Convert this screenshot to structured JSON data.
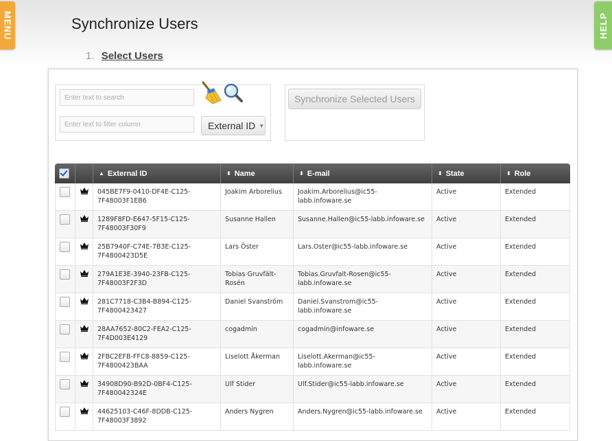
{
  "sidebar": {
    "menu_label": "MENU",
    "help_label": "HELP"
  },
  "header": {
    "title": "Synchronize Users",
    "step_number": "1.",
    "step_label": "Select Users"
  },
  "search": {
    "search_placeholder": "Enter text to search",
    "filter_placeholder": "Enter text to filter column",
    "column_selected": "External ID",
    "clear_icon": "broom-icon",
    "search_icon": "magnifier-icon"
  },
  "actions": {
    "sync_button_label": "Synchronize Selected Users"
  },
  "grid": {
    "columns": [
      {
        "label": "External ID",
        "sort": "▲"
      },
      {
        "label": "Name",
        "sort": "⬍"
      },
      {
        "label": "E-mail",
        "sort": "⬍"
      },
      {
        "label": "State",
        "sort": "⬍"
      },
      {
        "label": "Role",
        "sort": "⬍"
      }
    ],
    "row_icon": "crown-icon",
    "rows": [
      {
        "external_id": "045BE7F9-0410-DF4E-C125-7F48003F1EB6",
        "name": "Joakim Arborelius",
        "email": "Joakim.Arborelius@ic55-labb.infoware.se",
        "state": "Active",
        "role": "Extended"
      },
      {
        "external_id": "1289F8FD-E647-5F15-C125-7F48003F30F9",
        "name": "Susanne Hallen",
        "email": "Susanne.Hallen@ic55-labb.infoware.se",
        "state": "Active",
        "role": "Extended"
      },
      {
        "external_id": "25B7940F-C74E-7B3E-C125-7F4800423D5E",
        "name": "Lars Öster",
        "email": "Lars.Oster@ic55-labb.infoware.se",
        "state": "Active",
        "role": "Extended"
      },
      {
        "external_id": "279A1E3E-3940-23FB-C125-7F48003F2F3D",
        "name": "Tobias Gruvfält-Rosén",
        "email": "Tobias.Gruvfalt-Rosen@ic55-labb.infoware.se",
        "state": "Active",
        "role": "Extended"
      },
      {
        "external_id": "281C7718-C3B4-B894-C125-7F4800423427",
        "name": "Daniel Svanström",
        "email": "Daniel.Svanstrom@ic55-labb.infoware.se",
        "state": "Active",
        "role": "Extended"
      },
      {
        "external_id": "28AA7652-80C2-FEA2-C125-7F4D003E4129",
        "name": "cogadmin",
        "email": "cogadmin@infoware.se",
        "state": "Active",
        "role": "Extended"
      },
      {
        "external_id": "2FBC2EFB-FFC8-8859-C125-7F4800423BAA",
        "name": "Liselott Åkerman",
        "email": "Liselott.Akerman@ic55-labb.infoware.se",
        "state": "Active",
        "role": "Extended"
      },
      {
        "external_id": "34908D90-B92D-0BF4-C125-7F480042324E",
        "name": "Ulf Stider",
        "email": "Ulf.Stider@ic55-labb.infoware.se",
        "state": "Active",
        "role": "Extended"
      },
      {
        "external_id": "44625103-C46F-8DDB-C125-7F48003F3892",
        "name": "Anders Nygren",
        "email": "Anders.Nygren@ic55-labb.infoware.se",
        "state": "Active",
        "role": "Extended"
      }
    ]
  }
}
